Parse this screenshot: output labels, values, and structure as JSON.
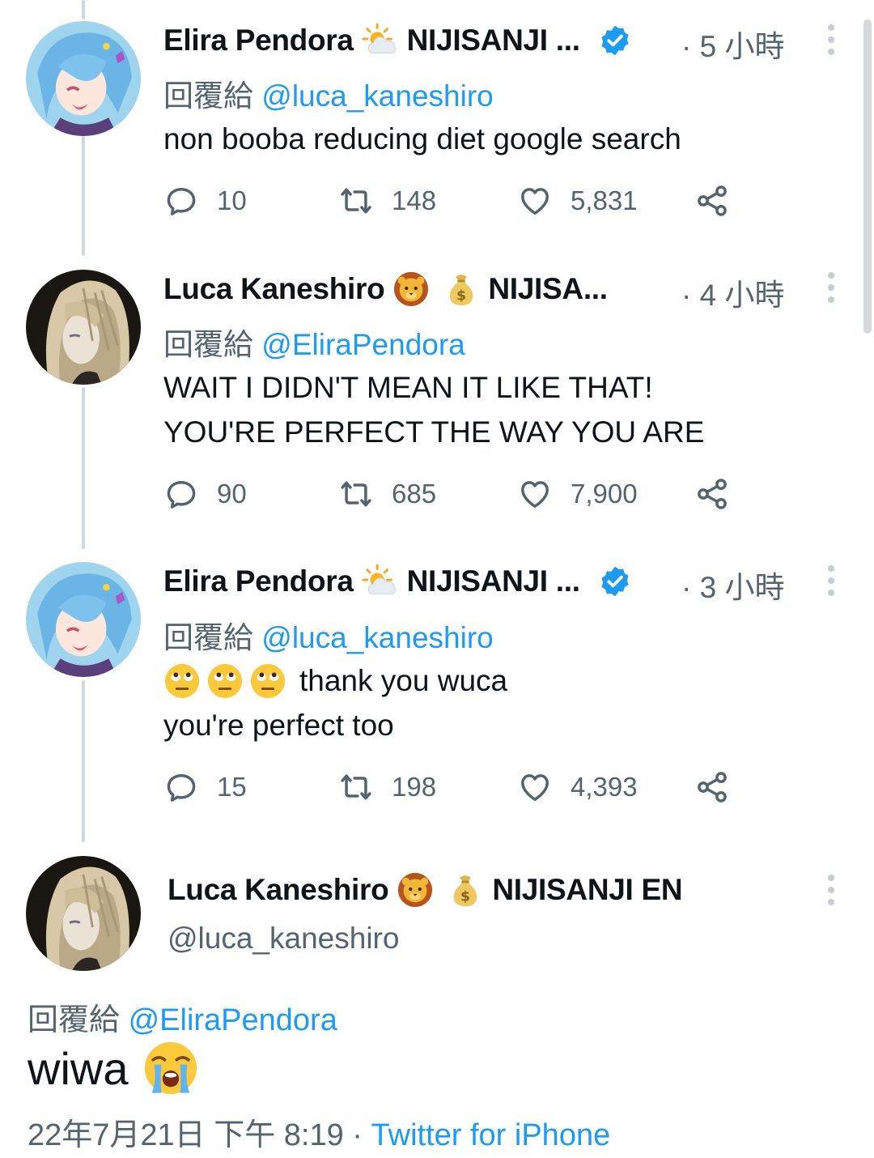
{
  "replies": [
    {
      "name": "Elira Pendora",
      "affiliation": "NIJISANJI ...",
      "time": "· 5 小時",
      "reply_prefix": "回覆給",
      "reply_handle": "@luca_kaneshiro",
      "text_lines": [
        "non booba reducing diet google search"
      ],
      "comments": "10",
      "retweets": "148",
      "likes": "5,831"
    },
    {
      "name": "Luca Kaneshiro",
      "affiliation": "NIJISA...",
      "time": "· 4 小時",
      "reply_prefix": "回覆給",
      "reply_handle": "@EliraPendora",
      "text_lines": [
        "WAIT I DIDN'T MEAN IT LIKE THAT!",
        "YOU'RE PERFECT THE WAY YOU ARE"
      ],
      "comments": "90",
      "retweets": "685",
      "likes": "7,900"
    },
    {
      "name": "Elira Pendora",
      "affiliation": "NIJISANJI ...",
      "time": "· 3 小時",
      "reply_prefix": "回覆給",
      "reply_handle": "@luca_kaneshiro",
      "text_lines": [
        "thank you wuca",
        "you're perfect too"
      ],
      "comments": "15",
      "retweets": "198",
      "likes": "4,393"
    }
  ],
  "main_tweet": {
    "name": "Luca Kaneshiro",
    "affiliation": "NIJISANJI EN",
    "handle": "@luca_kaneshiro",
    "reply_prefix": "回覆給",
    "reply_handle": "@EliraPendora",
    "text": "wiwa",
    "date": "22年7月21日 下午 8:19 ·",
    "source": "Twitter for iPhone"
  },
  "icons": {
    "reply": "speech-bubble-icon",
    "retweet": "retweet-icon",
    "like": "heart-icon",
    "share": "share-icon",
    "more": "vertical-dots-icon",
    "verified": "verified-badge-icon",
    "sun_cloud": "sun-behind-cloud-emoji",
    "lion": "lion-face-emoji",
    "money_bag": "money-bag-emoji",
    "eye_roll": "face-with-rolling-eyes-emoji",
    "crying": "loudly-crying-face-emoji"
  },
  "colors": {
    "link": "#1d9bf0",
    "secondary_text": "#536471",
    "primary_text": "#0f1419",
    "thread_line": "#cfd9de"
  }
}
